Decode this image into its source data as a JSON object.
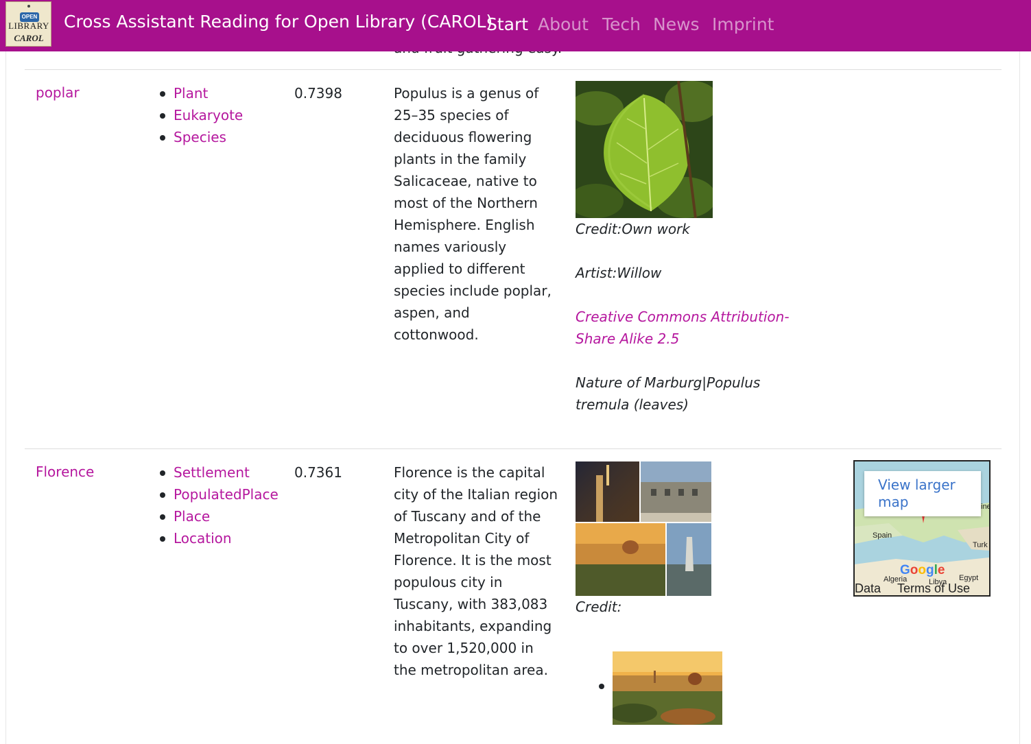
{
  "navbar": {
    "brand": "Cross Assistant Reading for Open Library (CAROL)",
    "logo": {
      "badge": "OPEN",
      "line1": "LIBRARY",
      "line2": "CAROL"
    },
    "items": [
      "Start",
      "About",
      "Tech",
      "News",
      "Imprint"
    ],
    "active": "Start"
  },
  "prev_row_tail": "and fruit gathering easy.",
  "rows": [
    {
      "term": "poplar",
      "types": [
        "Plant",
        "Eukaryote",
        "Species"
      ],
      "score": "0.7398",
      "description": "Populus is a genus of 25–35 species of deciduous flowering plants in the family Salicaceae, native to most of the Northern Hemisphere. English names variously applied to different species include poplar, aspen, and cottonwood.",
      "image": {
        "credit": "Credit:Own work",
        "artist": "Artist:Willow",
        "license": "Creative Commons Attribution-Share Alike 2.5",
        "caption": "Nature of Marburg|Populus tremula (leaves)"
      }
    },
    {
      "term": "Florence",
      "types": [
        "Settlement",
        "PopulatedPlace",
        "Place",
        "Location"
      ],
      "score": "0.7361",
      "description": "Florence is the capital city of the Italian region of Tuscany and of the Metropolitan City of Florence. It is the most populous city in Tuscany, with 383,083 inhabitants, expanding to over 1,520,000 in the metropolitan area.",
      "image": {
        "credit": "Credit:"
      },
      "map": {
        "link": "View larger map",
        "labels": [
          "Spain",
          "Turk",
          "Algeria",
          "Libya",
          "Egypt",
          "ine"
        ],
        "logo": "Google",
        "footer": [
          "Data",
          "Terms of Use"
        ]
      }
    }
  ],
  "colors": {
    "navbar": "#a7108c",
    "link": "#b5179e",
    "text": "#212529",
    "map_link": "#3a73c9"
  }
}
